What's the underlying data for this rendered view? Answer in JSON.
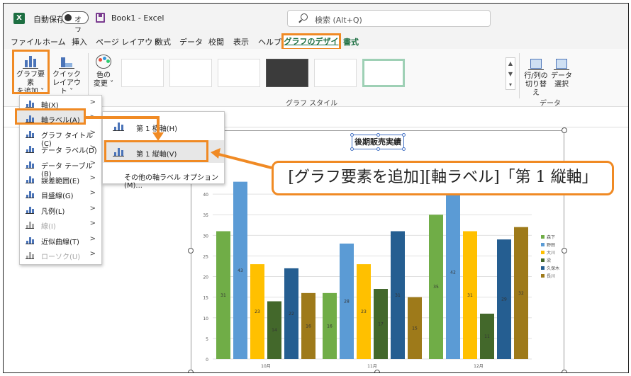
{
  "titlebar": {
    "autosave_label": "自動保存",
    "autosave_state": "オフ",
    "doc_title": "Book1  -  Excel",
    "search_placeholder": "検索 (Alt+Q)"
  },
  "menu": {
    "items": [
      "ファイル",
      "ホーム",
      "挿入",
      "ページ レイアウト",
      "数式",
      "データ",
      "校閲",
      "表示",
      "ヘルプ"
    ],
    "active": "グラフのデザイン",
    "after": "書式"
  },
  "ribbon": {
    "add_element": [
      "グラフ要素",
      "を追加"
    ],
    "quick_layout": [
      "クイック",
      "レイアウト"
    ],
    "change_color": [
      "色の",
      "変更"
    ],
    "chart_styles_group": "グラフ スタイル",
    "switch_row_col": [
      "行/列の",
      "切り替え"
    ],
    "select_data": [
      "データ",
      "選択"
    ],
    "data_group": "データ"
  },
  "dropdown": {
    "items": [
      {
        "label": "軸(X)",
        "disabled": false
      },
      {
        "label": "軸ラベル(A)",
        "disabled": false
      },
      {
        "label": "グラフ タイトル(C)",
        "disabled": false
      },
      {
        "label": "データ ラベル(D)",
        "disabled": false
      },
      {
        "label": "データ テーブル(B)",
        "disabled": false
      },
      {
        "label": "誤差範囲(E)",
        "disabled": false
      },
      {
        "label": "目盛線(G)",
        "disabled": false
      },
      {
        "label": "凡例(L)",
        "disabled": false
      },
      {
        "label": "線(I)",
        "disabled": true
      },
      {
        "label": "近似曲線(T)",
        "disabled": false
      },
      {
        "label": "ローソク(U)",
        "disabled": true
      }
    ]
  },
  "submenu": {
    "primary_horizontal": "第 1 横軸(H)",
    "primary_vertical": "第 1 縦軸(V)",
    "more_options": "その他の軸ラベル オプション(M)..."
  },
  "callout": "[グラフ要素を追加][軸ラベル]「第 1 縦軸」",
  "chart_data": {
    "type": "bar",
    "title": "後期販売実績",
    "categories": [
      "10月",
      "11月",
      "12月"
    ],
    "ylim": [
      0,
      45
    ],
    "yticks": [
      0,
      5,
      10,
      15,
      20,
      25,
      30,
      35,
      40
    ],
    "series": [
      {
        "name": "森下",
        "color": "#70ad47",
        "values": [
          31,
          16,
          35
        ]
      },
      {
        "name": "野田",
        "color": "#5b9bd5",
        "values": [
          43,
          28,
          42
        ]
      },
      {
        "name": "大川",
        "color": "#ffc000",
        "values": [
          23,
          23,
          31
        ]
      },
      {
        "name": "梁",
        "color": "#43682b",
        "values": [
          14,
          17,
          11
        ]
      },
      {
        "name": "久保木",
        "color": "#255e91",
        "values": [
          22,
          31,
          29
        ]
      },
      {
        "name": "長川",
        "color": "#9e7a1a",
        "values": [
          16,
          15,
          32
        ]
      }
    ],
    "legend": "right"
  }
}
